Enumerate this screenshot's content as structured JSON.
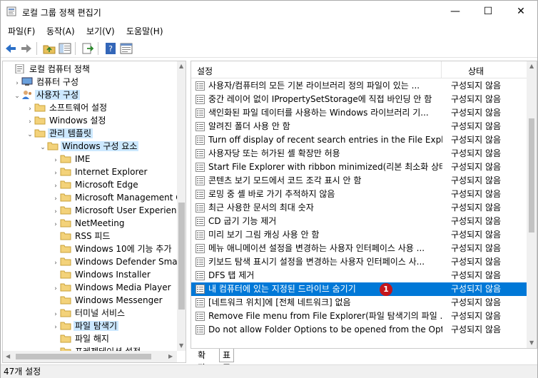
{
  "window": {
    "title": "로컬 그룹 정책 편집기",
    "controls": {
      "minimize": "—",
      "maximize": "☐",
      "close": "✕"
    }
  },
  "menu": [
    "파일(F)",
    "동작(A)",
    "보기(V)",
    "도움말(H)"
  ],
  "toolbar": {
    "icons": [
      "back-arrow-icon",
      "forward-arrow-icon",
      "up-folder-icon",
      "show-hide-tree-icon",
      "export-list-icon",
      "help-icon",
      "properties-icon"
    ]
  },
  "tree": [
    {
      "label": "로컬 컴퓨터 정책",
      "expander": "",
      "icon": "policy-icon",
      "selected": false
    },
    {
      "label": "컴퓨터 구성",
      "expander": "›",
      "icon": "computer-icon",
      "selected": false
    },
    {
      "label": "사용자 구성",
      "expander": "⌄",
      "icon": "user-icon",
      "selected": true
    },
    {
      "label": "소프트웨어 설정",
      "expander": "›",
      "icon": "folder-icon",
      "selected": false
    },
    {
      "label": "Windows 설정",
      "expander": "›",
      "icon": "folder-icon",
      "selected": false
    },
    {
      "label": "관리 템플릿",
      "expander": "⌄",
      "icon": "folder-icon",
      "selected": true
    },
    {
      "label": "Windows 구성 요소",
      "expander": "⌄",
      "icon": "folder-icon",
      "selected": true
    },
    {
      "label": "IME",
      "expander": "›",
      "icon": "folder-icon",
      "selected": false
    },
    {
      "label": "Internet Explorer",
      "expander": "›",
      "icon": "folder-icon",
      "selected": false
    },
    {
      "label": "Microsoft Edge",
      "expander": "›",
      "icon": "folder-icon",
      "selected": false
    },
    {
      "label": "Microsoft Management Co",
      "expander": "›",
      "icon": "folder-icon",
      "selected": false
    },
    {
      "label": "Microsoft User Experience",
      "expander": "›",
      "icon": "folder-icon",
      "selected": false
    },
    {
      "label": "NetMeeting",
      "expander": "›",
      "icon": "folder-icon",
      "selected": false
    },
    {
      "label": "RSS 피드",
      "expander": "",
      "icon": "folder-icon",
      "selected": false
    },
    {
      "label": "Windows 10에 기능 추가",
      "expander": "",
      "icon": "folder-icon",
      "selected": false
    },
    {
      "label": "Windows Defender Smart",
      "expander": "›",
      "icon": "folder-icon",
      "selected": false
    },
    {
      "label": "Windows Installer",
      "expander": "",
      "icon": "folder-icon",
      "selected": false
    },
    {
      "label": "Windows Media Player",
      "expander": "›",
      "icon": "folder-icon",
      "selected": false
    },
    {
      "label": "Windows Messenger",
      "expander": "",
      "icon": "folder-icon",
      "selected": false
    },
    {
      "label": "터미널 서비스",
      "expander": "›",
      "icon": "folder-icon",
      "selected": false
    },
    {
      "label": "파일 탐색기",
      "expander": "›",
      "icon": "folder-icon",
      "selected": true
    },
    {
      "label": "파일 해지",
      "expander": "",
      "icon": "folder-icon",
      "selected": false
    },
    {
      "label": "프레젠테이션 설정",
      "expander": "",
      "icon": "folder-icon",
      "selected": false
    }
  ],
  "list": {
    "headers": {
      "setting": "설정",
      "state": "상태"
    },
    "rows": [
      {
        "name": "사용자/컴퓨터의 모든 기본 라이브러리 정의 파일이 있는 ...",
        "state": "구성되지 않음"
      },
      {
        "name": "중간 레이어 없이 IPropertySetStorage에 직접 바인딩 안 함",
        "state": "구성되지 않음"
      },
      {
        "name": "색인화된 파일 데이터를 사용하는 Windows 라이브러리 기...",
        "state": "구성되지 않음"
      },
      {
        "name": "알려진 폴더 사용 안 함",
        "state": "구성되지 않음"
      },
      {
        "name": "Turn off display of recent search entries in the File Explorer...",
        "state": "구성되지 않음"
      },
      {
        "name": "사용자당 또는 허가된 셸 확장만 허용",
        "state": "구성되지 않음"
      },
      {
        "name": "Start File Explorer with ribbon minimized(리본 최소화 상태...",
        "state": "구성되지 않음"
      },
      {
        "name": "콘텐츠 보기 모드에서 코드 조각 표시 안 함",
        "state": "구성되지 않음"
      },
      {
        "name": "로밍 중 셸 바로 가기 추적하지 않음",
        "state": "구성되지 않음"
      },
      {
        "name": "최근 사용한 문서의 최대 숫자",
        "state": "구성되지 않음"
      },
      {
        "name": "CD 굽기 기능 제거",
        "state": "구성되지 않음"
      },
      {
        "name": "미리 보기 그림 캐싱 사용 안 함",
        "state": "구성되지 않음"
      },
      {
        "name": "메뉴 애니메이션 설정을 변경하는 사용자 인터페이스 사용 ...",
        "state": "구성되지 않음"
      },
      {
        "name": "키보드 탐색 표시기 설정을 변경하는 사용자 인터페이스 사...",
        "state": "구성되지 않음"
      },
      {
        "name": "DFS 탭 제거",
        "state": "구성되지 않음"
      },
      {
        "name": "내 컴퓨터에 있는 지정된 드라이브 숨기기",
        "state": "구성되지 않음",
        "selected": true,
        "badge": "1"
      },
      {
        "name": "[네트워크 위치]에 [전체 네트워크] 없음",
        "state": "구성되지 않음"
      },
      {
        "name": "Remove File menu from File Explorer(파일 탐색기의 파일 ...",
        "state": "구성되지 않음"
      },
      {
        "name": "Do not allow Folder Options to be opened from the Optio...",
        "state": "구성되지 않음"
      }
    ]
  },
  "tabs": [
    "확장",
    "표준"
  ],
  "status": "47개 설정",
  "colors": {
    "selection": "#0078d7",
    "tree_selection": "#cce8ff",
    "badge": "#c4161c"
  }
}
